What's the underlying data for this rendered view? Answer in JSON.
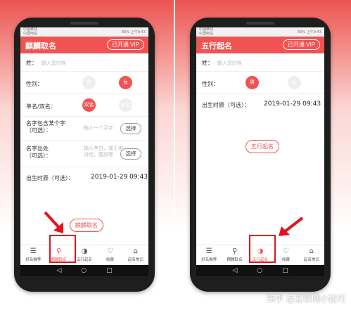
{
  "left": {
    "status": {
      "carrier_line1": "中国移动",
      "carrier_line2": "中国电信",
      "right": "83%  上午9:43"
    },
    "title": "麒麟取名",
    "vip": "已开通 VIP",
    "surname": {
      "label": "姓：",
      "placeholder": "输入您的姓"
    },
    "gender": {
      "label": "性别：",
      "male": "男",
      "female": "女"
    },
    "name_type": {
      "label": "单名/双名：",
      "double": "双名",
      "single": "单名"
    },
    "include_char": {
      "label_line1": "名字包含某个字",
      "label_line2": "（可选）：",
      "placeholder": "输入一个汉字",
      "button": "选择"
    },
    "source": {
      "label_line1": "名字出处",
      "label_line2": "（可选）：",
      "placeholder_line1": "输入李白，或王维，",
      "placeholder_line2": "诗经，楚辞等",
      "button": "选择"
    },
    "birth": {
      "label": "出生时辰（可选）：",
      "value": "2019-01-29 09:43"
    },
    "action": "麒麟取名",
    "tabs": [
      "好名推荐",
      "麒麟取名",
      "五行起名",
      "收藏",
      "起名常识"
    ]
  },
  "right": {
    "status": {
      "carrier_line1": "中国移动",
      "carrier_line2": "中国电信",
      "right": "83%  上午9:43"
    },
    "title": "五行起名",
    "vip": "已开通 VIP",
    "surname": {
      "label": "姓：",
      "placeholder": "输入您的姓"
    },
    "gender": {
      "label": "性别：",
      "male": "男",
      "female": "女"
    },
    "birth": {
      "label": "出生时辰（可选）：",
      "value": "2019-01-29 09:43"
    },
    "action": "五行起名",
    "tabs": [
      "好名推荐",
      "麒麟取名",
      "五行起名",
      "收藏",
      "起名常识"
    ]
  },
  "nav": {
    "back": "◁",
    "home": "○",
    "recent": "□"
  },
  "watermark": "知乎 @互联网小技巧",
  "colors": {
    "accent": "#f05452",
    "highlight": "#e0151f"
  }
}
